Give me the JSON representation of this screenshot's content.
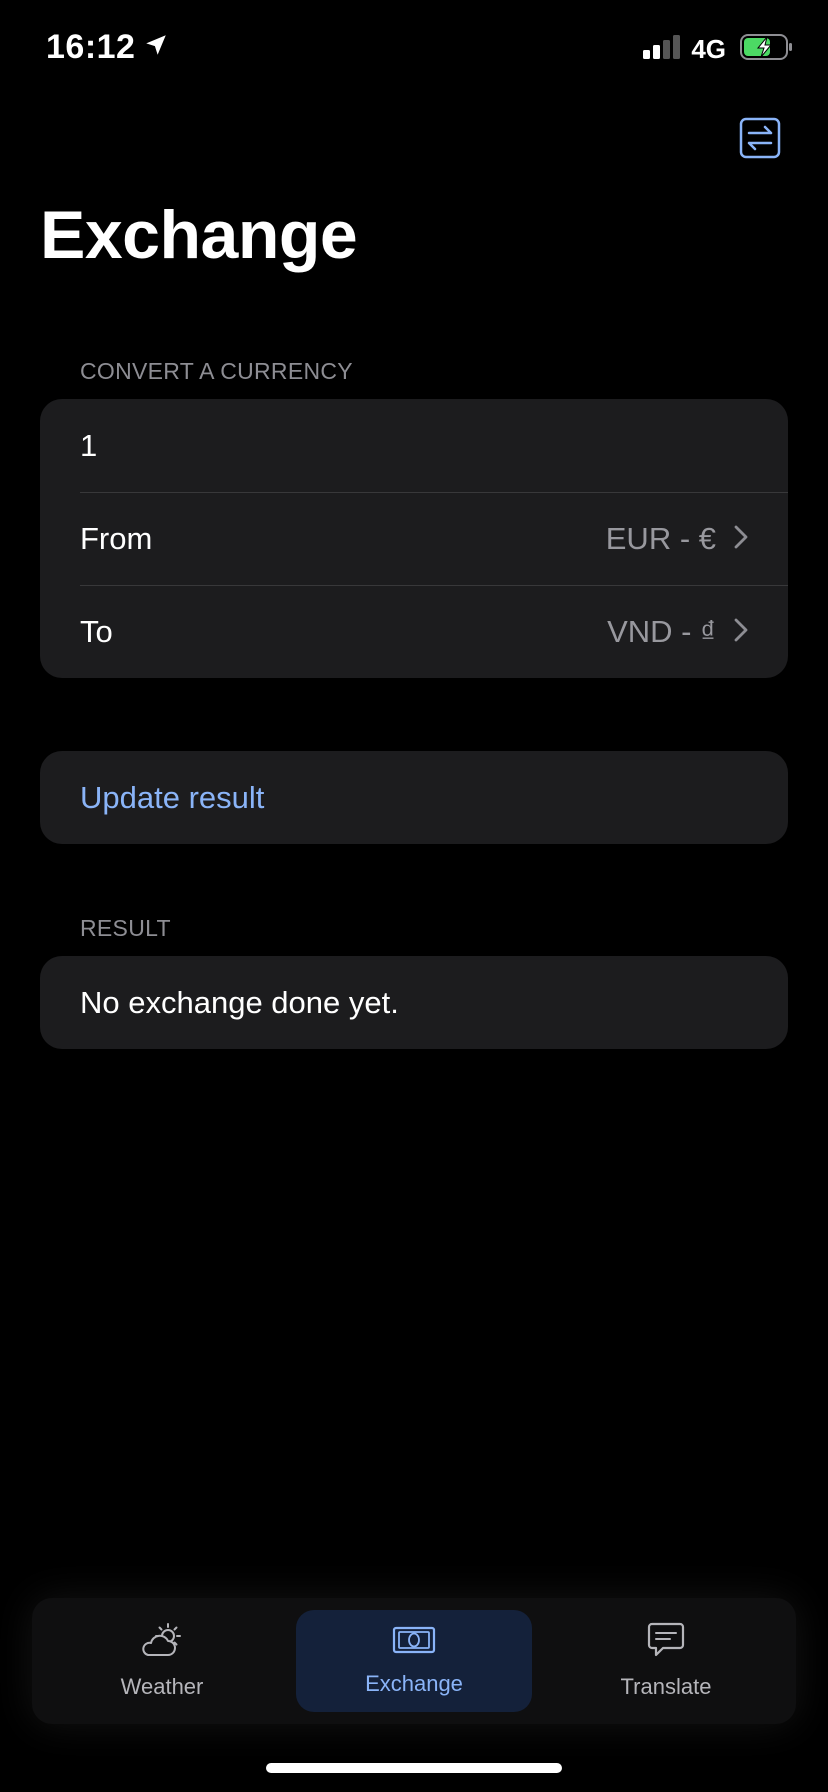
{
  "status_bar": {
    "time": "16:12",
    "network": "4G",
    "location_icon": "location-arrow-icon",
    "signal_icon": "cellular-signal-icon",
    "battery_icon": "battery-charging-icon"
  },
  "header": {
    "title": "Exchange",
    "action_icon": "swap-arrows-icon"
  },
  "convert_section": {
    "header": "CONVERT A CURRENCY",
    "amount": "1",
    "from_label": "From",
    "from_value": "EUR - €",
    "to_label": "To",
    "to_value": "VND - ₫"
  },
  "actions": {
    "update_label": "Update result"
  },
  "result_section": {
    "header": "RESULT",
    "text": "No exchange done yet."
  },
  "tab_bar": {
    "active": "Exchange",
    "tabs": [
      {
        "label": "Weather",
        "icon": "cloud-sun-icon"
      },
      {
        "label": "Exchange",
        "icon": "banknote-icon"
      },
      {
        "label": "Translate",
        "icon": "speech-bubble-icon"
      }
    ]
  },
  "colors": {
    "accent": "#8ab4f8",
    "background": "#000000",
    "card": "#1c1c1e",
    "secondary_text": "#8d8d93",
    "battery_fill": "#4cd964"
  }
}
